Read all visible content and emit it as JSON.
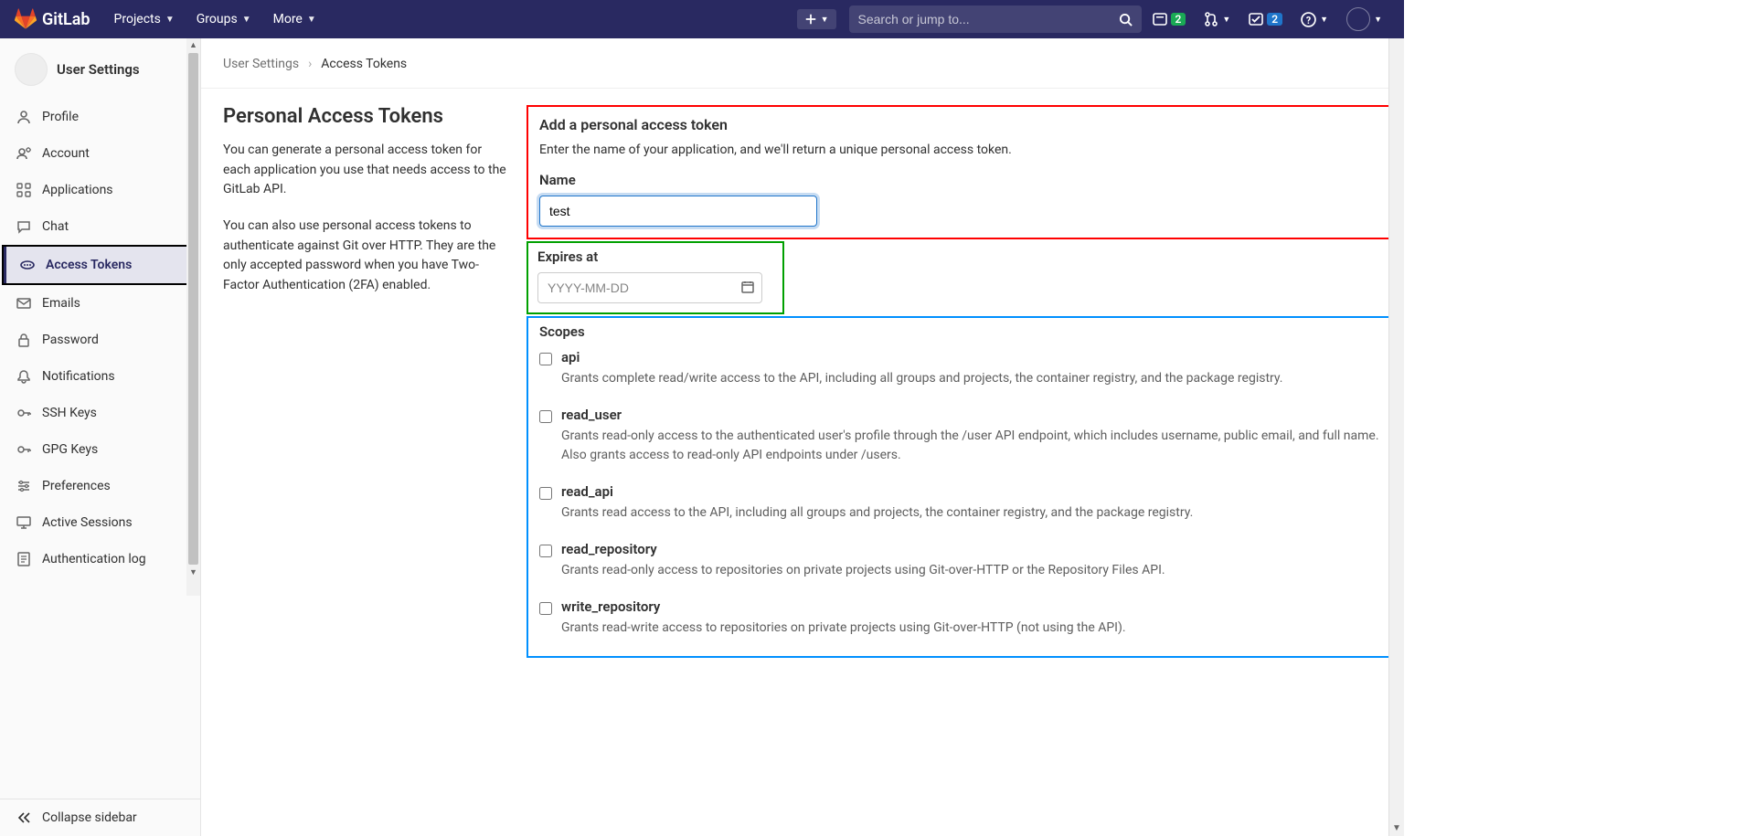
{
  "nav": {
    "brand": "GitLab",
    "projects": "Projects",
    "groups": "Groups",
    "more": "More",
    "search_placeholder": "Search or jump to...",
    "issues_count": "2",
    "mr_count": "",
    "todos_count": "2"
  },
  "sidebar": {
    "title": "User Settings",
    "items": [
      {
        "label": "Profile"
      },
      {
        "label": "Account"
      },
      {
        "label": "Applications"
      },
      {
        "label": "Chat"
      },
      {
        "label": "Access Tokens"
      },
      {
        "label": "Emails"
      },
      {
        "label": "Password"
      },
      {
        "label": "Notifications"
      },
      {
        "label": "SSH Keys"
      },
      {
        "label": "GPG Keys"
      },
      {
        "label": "Preferences"
      },
      {
        "label": "Active Sessions"
      },
      {
        "label": "Authentication log"
      }
    ],
    "collapse": "Collapse sidebar"
  },
  "breadcrumb": {
    "a": "User Settings",
    "b": "Access Tokens"
  },
  "left": {
    "heading": "Personal Access Tokens",
    "p1": "You can generate a personal access token for each application you use that needs access to the GitLab API.",
    "p2": "You can also use personal access tokens to authenticate against Git over HTTP. They are the only accepted password when you have Two-Factor Authentication (2FA) enabled."
  },
  "form": {
    "add_title": "Add a personal access token",
    "add_sub": "Enter the name of your application, and we'll return a unique personal access token.",
    "name_label": "Name",
    "name_value": "test",
    "expires_label": "Expires at",
    "expires_placeholder": "YYYY-MM-DD",
    "scopes_label": "Scopes",
    "scopes": [
      {
        "name": "api",
        "desc": "Grants complete read/write access to the API, including all groups and projects, the container registry, and the package registry."
      },
      {
        "name": "read_user",
        "desc": "Grants read-only access to the authenticated user's profile through the /user API endpoint, which includes username, public email, and full name. Also grants access to read-only API endpoints under /users."
      },
      {
        "name": "read_api",
        "desc": "Grants read access to the API, including all groups and projects, the container registry, and the package registry."
      },
      {
        "name": "read_repository",
        "desc": "Grants read-only access to repositories on private projects using Git-over-HTTP or the Repository Files API."
      },
      {
        "name": "write_repository",
        "desc": "Grants read-write access to repositories on private projects using Git-over-HTTP (not using the API)."
      }
    ]
  }
}
